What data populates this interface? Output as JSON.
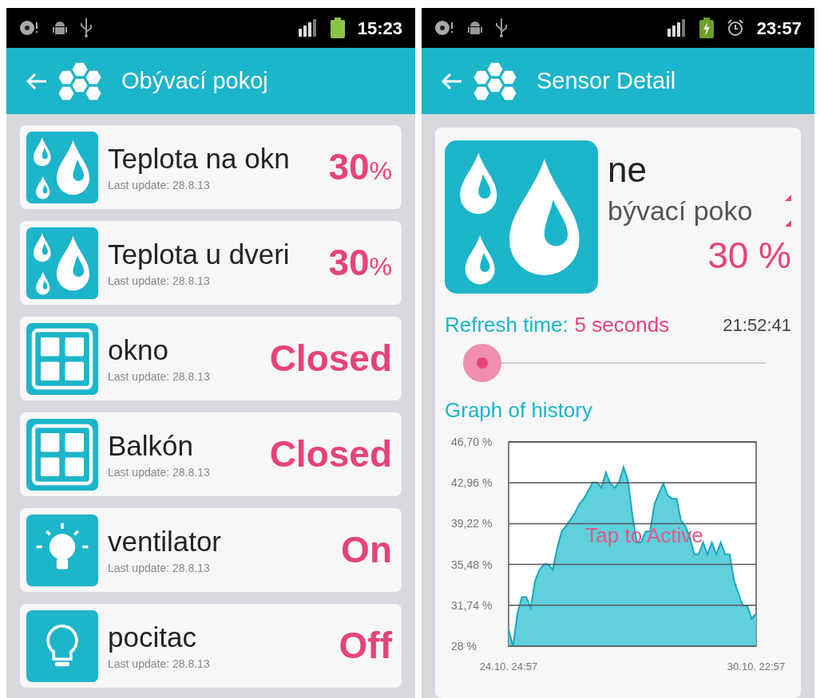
{
  "screens": [
    {
      "status_bar": {
        "time": "15:23",
        "right_icons": [
          {
            "kind": "signal"
          },
          {
            "kind": "battery"
          }
        ]
      },
      "header": {
        "title": "Obývací pokoj"
      },
      "devices": [
        {
          "kind": "humidity",
          "name": "Teplota na okn",
          "updated": "Last update: 28.8.13",
          "value": "30",
          "unit": "%"
        },
        {
          "kind": "humidity",
          "name": "Teplota u dveri",
          "updated": "Last update: 28.8.13",
          "value": "30",
          "unit": "%"
        },
        {
          "kind": "window",
          "name": "okno",
          "updated": "Last update: 28.8.13",
          "value": "Closed"
        },
        {
          "kind": "window",
          "name": "Balkón",
          "updated": "Last update: 28.8.13",
          "value": "Closed"
        },
        {
          "kind": "light_on",
          "name": "ventilator",
          "updated": "Last update: 28.8.13",
          "value": "On"
        },
        {
          "kind": "light_off",
          "name": "pocitac",
          "updated": "Last update: 28.8.13",
          "value": "Off"
        }
      ]
    },
    {
      "status_bar": {
        "time": "23:57",
        "right_icons": [
          {
            "kind": "signal"
          },
          {
            "kind": "battery_charging"
          },
          {
            "kind": "alarm"
          }
        ]
      },
      "header": {
        "title": "Sensor Detail"
      },
      "detail": {
        "kind": "humidity",
        "name": "ne",
        "location": "bývací poko",
        "value": "30 %",
        "refresh_label": "Refresh time:",
        "refresh_value": "5 seconds",
        "time": "21:52:41",
        "slider": {
          "level": 0.04
        },
        "graph_title": "Graph of history",
        "overlay": "Tap to Active",
        "chart_data": {
          "type": "area",
          "grid": true,
          "ylim": [
            28,
            46.7
          ],
          "yticks": [
            {
              "value": 28,
              "label": "28 %"
            },
            {
              "value": 31.74,
              "label": "31,74 %"
            },
            {
              "value": 35.48,
              "label": "35,48 %"
            },
            {
              "value": 39.22,
              "label": "39,22 %"
            },
            {
              "value": 42.96,
              "label": "42,96 %"
            },
            {
              "value": 46.7,
              "label": "46,70 %"
            }
          ],
          "categories": [
            "24.10. 24:57",
            null,
            null,
            null,
            null,
            null,
            null,
            null,
            null,
            null,
            null,
            null,
            null,
            null,
            null,
            null,
            null,
            null,
            null,
            null,
            null,
            null,
            null,
            null,
            null,
            null,
            null,
            null,
            null,
            null,
            null,
            null,
            null,
            null,
            null,
            null,
            null,
            null,
            null,
            null,
            null,
            null,
            null,
            null,
            null,
            null,
            null,
            null,
            null,
            null,
            null,
            null,
            null,
            null,
            null,
            null,
            "30.10. 22:57"
          ],
          "series": [
            {
              "color": "#5fd0dc",
              "values": [
                29.5,
                28,
                31,
                32.5,
                32.5,
                31.5,
                34,
                35,
                35.5,
                35.5,
                35,
                37,
                38.5,
                39,
                39.6,
                40.2,
                41,
                41.5,
                42.2,
                43,
                43,
                42.5,
                43.9,
                42.9,
                42.5,
                43,
                44.4,
                43.2,
                40,
                37.5,
                37.5,
                38.5,
                38.5,
                41,
                42,
                42.9,
                41.8,
                41.5,
                41.5,
                39.5,
                39,
                38,
                36.4,
                36.4,
                37.5,
                36.4,
                37.5,
                36.4,
                37.5,
                36.4,
                36.4,
                34,
                32.8,
                31.7,
                31.7,
                30.5,
                31
              ]
            }
          ]
        }
      }
    }
  ]
}
